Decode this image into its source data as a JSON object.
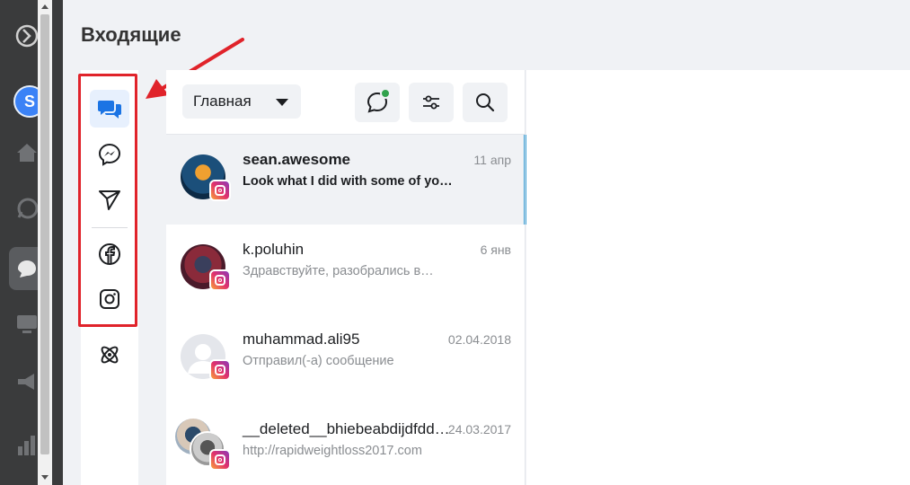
{
  "header": {
    "title": "Входящие"
  },
  "rail": {
    "avatar_letter": "S"
  },
  "toolbar": {
    "filter_label": "Главная"
  },
  "channels": [
    {
      "icon": "chat-bubbles-icon",
      "active": true
    },
    {
      "icon": "messenger-icon"
    },
    {
      "icon": "send-icon"
    },
    {
      "icon": "facebook-icon"
    },
    {
      "icon": "instagram-icon"
    },
    {
      "icon": "atom-icon"
    }
  ],
  "conversations": [
    {
      "name": "sean.awesome",
      "date": "11 апр",
      "message": "Look what I did with some of yo…",
      "platform": "instagram",
      "selected": true
    },
    {
      "name": "k.poluhin",
      "date": "6 янв",
      "message": "Здравствуйте, разобрались в…",
      "platform": "instagram"
    },
    {
      "name": "muhammad.ali95",
      "date": "02.04.2018",
      "message": "Отправил(-а) сообщение",
      "platform": "instagram"
    },
    {
      "name": "__deleted__bhiebeabdijdfdd…",
      "date": "24.03.2017",
      "message": "http://rapidweightloss2017.com",
      "platform": "instagram"
    }
  ],
  "colors": {
    "accent": "#1b74e4",
    "highlight": "#e0232a",
    "online": "#31a24c"
  }
}
